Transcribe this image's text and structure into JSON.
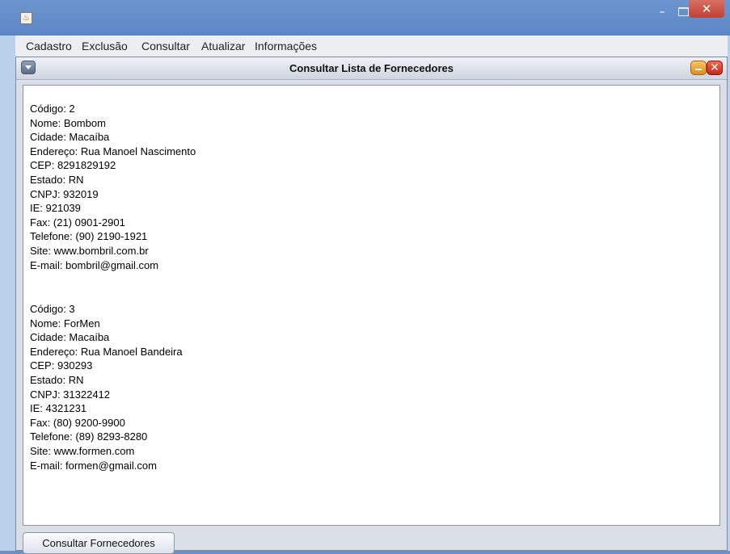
{
  "window": {
    "icon": "java-icon",
    "minimize_glyph": "–",
    "close_glyph": "✕"
  },
  "menubar": {
    "items": [
      "Cadastro",
      "Exclusão",
      "Consultar",
      "Atualizar",
      "Informações"
    ]
  },
  "internal_frame": {
    "title": "Consultar Lista de Fornecedores",
    "close_glyph": "✕"
  },
  "records": [
    {
      "lines": [
        "Código: 2",
        "Nome: Bombom",
        "Cidade: Macaíba",
        "Endereço: Rua Manoel Nascimento",
        "CEP: 8291829192",
        "Estado: RN",
        "CNPJ: 932019",
        "IE: 921039",
        "Fax: (21) 0901-2901",
        "Telefone: (90) 2190-1921",
        "Site: www.bombril.com.br",
        "E-mail: bombril@gmail.com"
      ]
    },
    {
      "lines": [
        "Código: 3",
        "Nome: ForMen",
        "Cidade: Macaíba",
        "Endereço: Rua Manoel Bandeira",
        "CEP: 930293",
        "Estado: RN",
        "CNPJ: 31322412",
        "IE: 4321231",
        "Fax: (80) 9200-9900",
        "Telefone: (89) 8293-8280",
        "Site: www.formen.com",
        "E-mail: formen@gmail.com"
      ]
    }
  ],
  "buttons": {
    "consultar": "Consultar Fornecedores"
  },
  "colors": {
    "titlebar": "#5b86c6",
    "close_button": "#c24133",
    "internal_min": "#e28a1b",
    "internal_close": "#c5291a"
  }
}
